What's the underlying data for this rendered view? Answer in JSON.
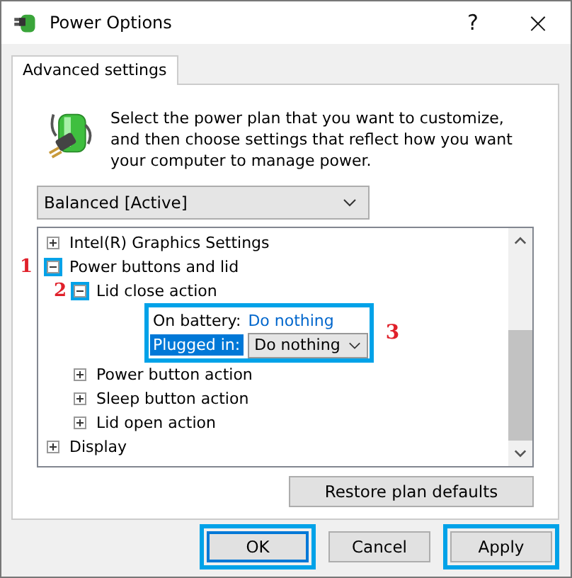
{
  "window": {
    "title": "Power Options",
    "help": "?",
    "close": "×"
  },
  "tabs": [
    {
      "label": "Advanced settings",
      "selected": true
    }
  ],
  "intro": "Select the power plan that you want to customize, and then choose settings that reflect how you want your computer to manage power.",
  "plan": {
    "value": "Balanced [Active]"
  },
  "tree": [
    {
      "label": "Intel(R) Graphics Settings",
      "expanded": false,
      "highlighted": false
    },
    {
      "label": "Power buttons and lid",
      "expanded": true,
      "highlighted": true,
      "annotation": "1",
      "children": [
        {
          "label": "Lid close action",
          "expanded": true,
          "highlighted": true,
          "annotation": "2",
          "settings_highlighted": true,
          "settings_annotation": "3",
          "settings": [
            {
              "label": "On battery:",
              "value": "Do nothing",
              "kind": "link",
              "selected": false
            },
            {
              "label": "Plugged in:",
              "value": "Do nothing",
              "kind": "dropdown",
              "selected": true
            }
          ]
        },
        {
          "label": "Power button action",
          "expanded": false,
          "highlighted": false
        },
        {
          "label": "Sleep button action",
          "expanded": false,
          "highlighted": false
        },
        {
          "label": "Lid open action",
          "expanded": false,
          "highlighted": false
        }
      ]
    },
    {
      "label": "Display",
      "expanded": false,
      "highlighted": false
    }
  ],
  "restore_button": "Restore plan defaults",
  "buttons": [
    {
      "label": "OK",
      "highlighted": true,
      "default": true
    },
    {
      "label": "Cancel",
      "highlighted": false,
      "default": false
    },
    {
      "label": "Apply",
      "highlighted": true,
      "default": false
    }
  ]
}
